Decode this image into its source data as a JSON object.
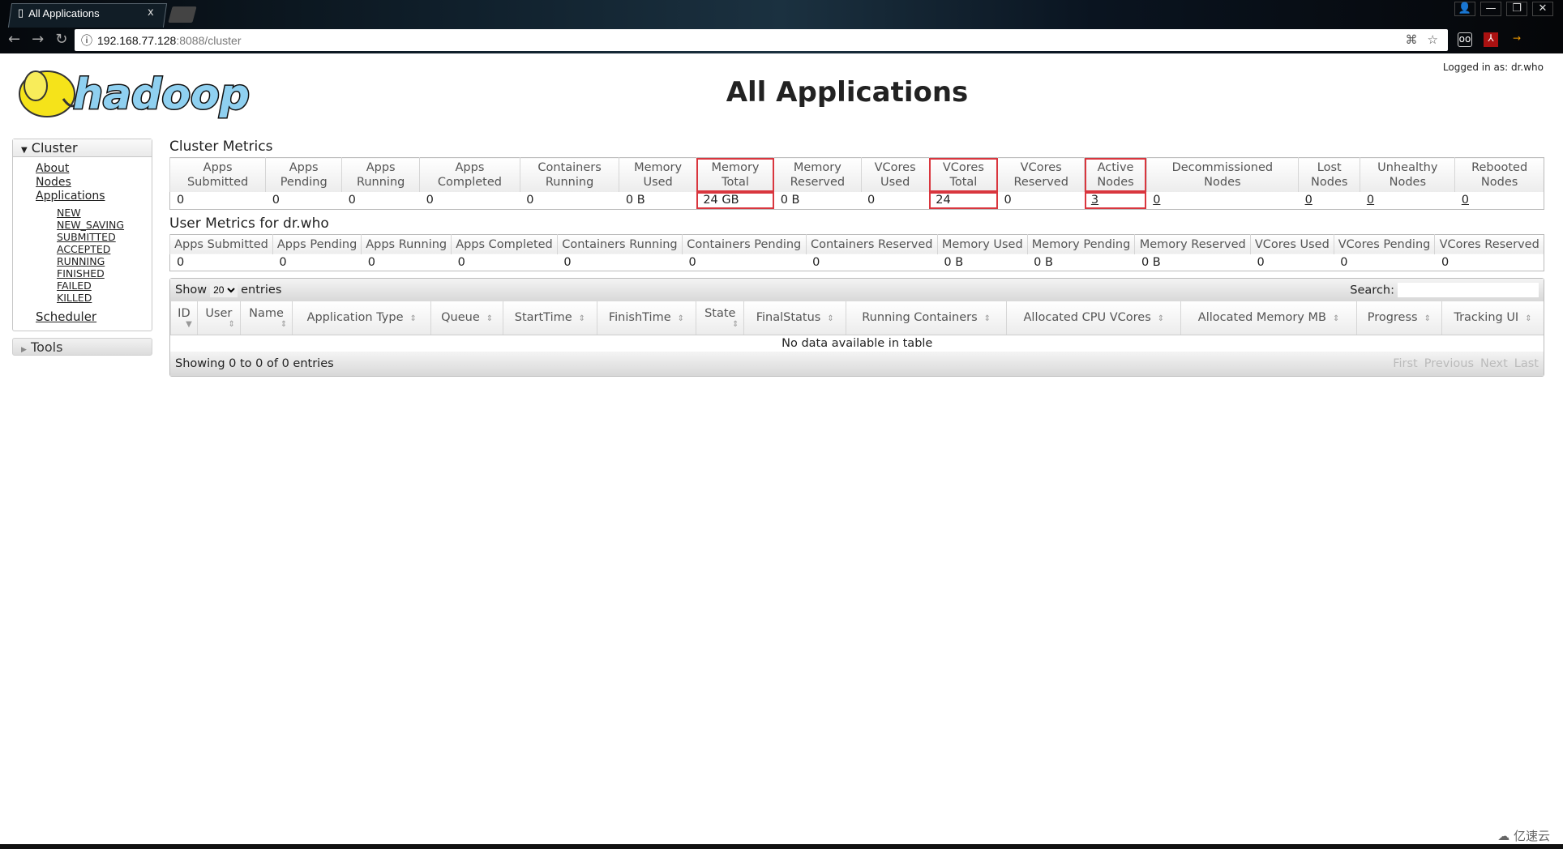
{
  "browser": {
    "tab_title": "All Applications",
    "tab_close": "x",
    "url_host": "192.168.77.128",
    "url_rest": ":8088/cluster"
  },
  "page": {
    "title": "All Applications",
    "logged_in": "Logged in as: dr.who",
    "logo_text": "hadoop"
  },
  "sidebar": {
    "cluster": "Cluster",
    "links": [
      "About",
      "Nodes",
      "Applications"
    ],
    "states": [
      "NEW",
      "NEW_SAVING",
      "SUBMITTED",
      "ACCEPTED",
      "RUNNING",
      "FINISHED",
      "FAILED",
      "KILLED"
    ],
    "scheduler": "Scheduler",
    "tools": "Tools"
  },
  "cluster_metrics": {
    "title": "Cluster Metrics",
    "headers": [
      [
        "Apps",
        "Submitted"
      ],
      [
        "Apps",
        "Pending"
      ],
      [
        "Apps",
        "Running"
      ],
      [
        "Apps",
        "Completed"
      ],
      [
        "Containers",
        "Running"
      ],
      [
        "Memory",
        "Used"
      ],
      [
        "Memory",
        "Total"
      ],
      [
        "Memory",
        "Reserved"
      ],
      [
        "VCores",
        "Used"
      ],
      [
        "VCores",
        "Total"
      ],
      [
        "VCores",
        "Reserved"
      ],
      [
        "Active",
        "Nodes"
      ],
      [
        "Decommissioned",
        "Nodes"
      ],
      [
        "Lost",
        "Nodes"
      ],
      [
        "Unhealthy",
        "Nodes"
      ],
      [
        "Rebooted",
        "Nodes"
      ]
    ],
    "values": [
      "0",
      "0",
      "0",
      "0",
      "0",
      "0 B",
      "24 GB",
      "0 B",
      "0",
      "24",
      "0",
      "3",
      "0",
      "0",
      "0",
      "0"
    ],
    "highlighted": [
      "Memory Total",
      "VCores Total",
      "Active Nodes"
    ],
    "highlight_color": "#d9363e"
  },
  "user_metrics": {
    "title": "User Metrics for dr.who",
    "headers": [
      "Apps Submitted",
      "Apps Pending",
      "Apps Running",
      "Apps Completed",
      "Containers Running",
      "Containers Pending",
      "Containers Reserved",
      "Memory Used",
      "Memory Pending",
      "Memory Reserved",
      "VCores Used",
      "VCores Pending",
      "VCores Reserved"
    ],
    "values": [
      "0",
      "0",
      "0",
      "0",
      "0",
      "0",
      "0",
      "0 B",
      "0 B",
      "0 B",
      "0",
      "0",
      "0"
    ]
  },
  "apps_table": {
    "show": "Show",
    "entries_value": "20",
    "entries": "entries",
    "search_label": "Search:",
    "search_value": "",
    "columns": [
      "ID",
      "User",
      "Name",
      "Application Type",
      "Queue",
      "StartTime",
      "FinishTime",
      "State",
      "FinalStatus",
      "Running Containers",
      "Allocated CPU VCores",
      "Allocated Memory MB",
      "Progress",
      "Tracking UI"
    ],
    "empty": "No data available in table",
    "info": "Showing 0 to 0 of 0 entries",
    "pager": [
      "First",
      "Previous",
      "Next",
      "Last"
    ]
  },
  "watermark": "亿速云"
}
